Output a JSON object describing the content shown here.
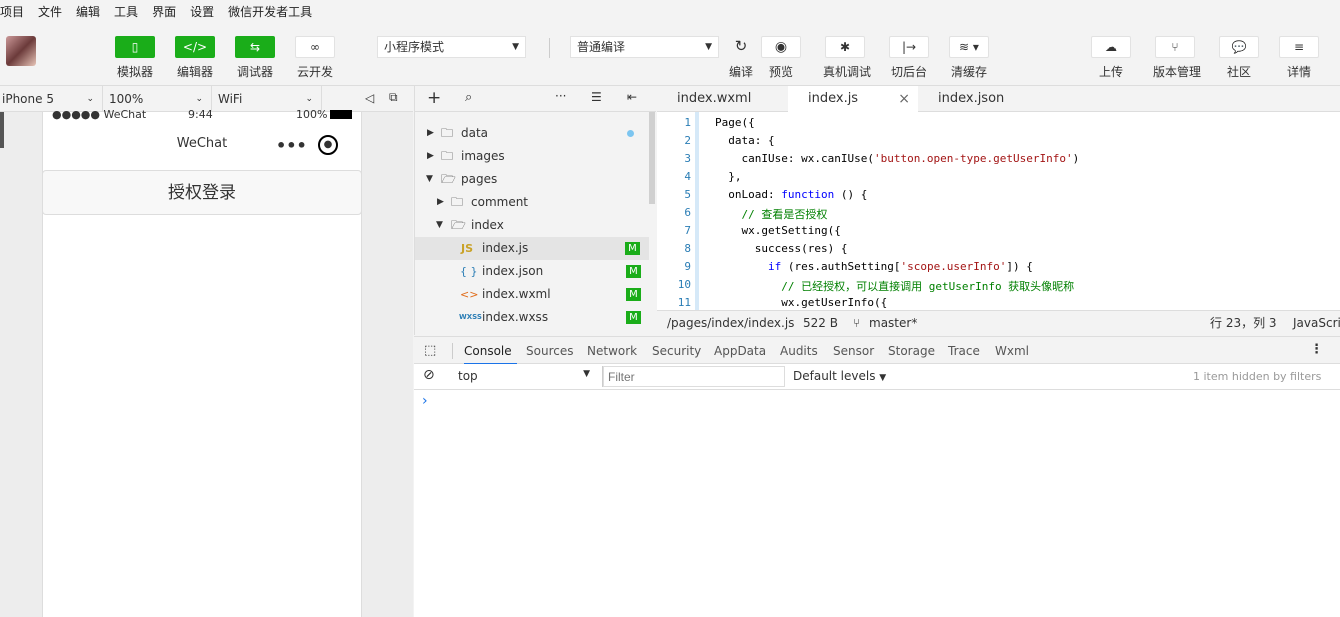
{
  "menubar": [
    "项目",
    "文件",
    "编辑",
    "工具",
    "界面",
    "设置",
    "微信开发者工具"
  ],
  "toolbar": {
    "simulator": "模拟器",
    "editor": "编辑器",
    "debugger": "调试器",
    "cloud": "云开发",
    "mode_select": "小程序模式",
    "compile_select": "普通编译",
    "compile": "编译",
    "preview": "预览",
    "remote_debug": "真机调试",
    "background": "切后台",
    "clear_cache": "清缓存",
    "upload": "上传",
    "version": "版本管理",
    "community": "社区",
    "details": "详情"
  },
  "device": {
    "model": "iPhone 5",
    "zoom": "100%",
    "network": "WiFi"
  },
  "phone": {
    "carrier": "●●●●● WeChat",
    "time": "9:44",
    "battery": "100%",
    "nav_title": "WeChat",
    "auth_button": "授权登录"
  },
  "filetree": {
    "items": [
      {
        "name": "data",
        "type": "folder",
        "expanded": false
      },
      {
        "name": "images",
        "type": "folder",
        "expanded": false
      },
      {
        "name": "pages",
        "type": "folder",
        "expanded": true
      },
      {
        "name": "comment",
        "type": "folder",
        "expanded": false
      },
      {
        "name": "index",
        "type": "folder",
        "expanded": true
      },
      {
        "name": "index.js",
        "type": "js",
        "badge": "M"
      },
      {
        "name": "index.json",
        "type": "json",
        "badge": "M"
      },
      {
        "name": "index.wxml",
        "type": "wxml",
        "badge": "M"
      },
      {
        "name": "index.wxss",
        "type": "wxss",
        "badge": "M"
      }
    ]
  },
  "editor": {
    "tabs": [
      "index.wxml",
      "index.js",
      "index.json"
    ],
    "active_tab": "index.js",
    "lines": [
      "1",
      "2",
      "3",
      "4",
      "5",
      "6",
      "7",
      "8",
      "9",
      "10",
      "11"
    ],
    "status": {
      "path": "/pages/index/index.js",
      "size": "522 B",
      "branch": "master*",
      "position": "行 23，列 3",
      "language": "JavaScript"
    }
  },
  "devtools": {
    "tabs": [
      "Console",
      "Sources",
      "Network",
      "Security",
      "AppData",
      "Audits",
      "Sensor",
      "Storage",
      "Trace",
      "Wxml"
    ],
    "active_tab": "Console",
    "context": "top",
    "filter_placeholder": "Filter",
    "levels": "Default levels",
    "hidden": "1 item hidden by filters",
    "prompt": "›"
  },
  "colors": {
    "accent_green": "#1aad19",
    "line_number": "#2a7db5"
  }
}
